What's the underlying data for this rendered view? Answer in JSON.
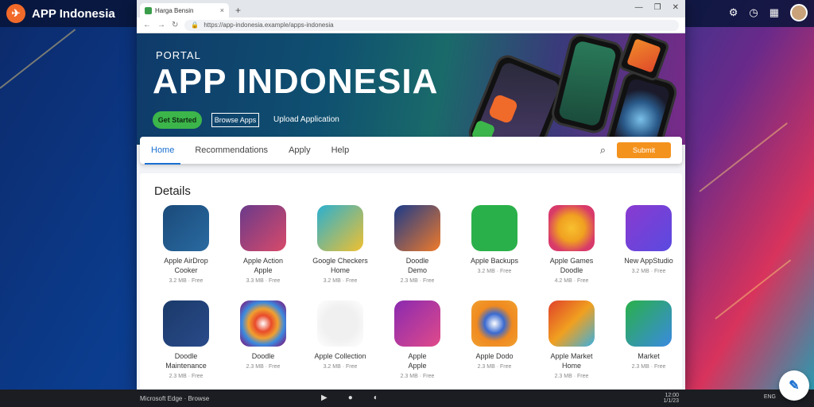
{
  "desktop": {
    "title": "APP Indonesia",
    "logo_glyph": "✈"
  },
  "browser": {
    "tab_title": "Harga Bensin",
    "url": "https://app-indonesia.example/apps-indonesia"
  },
  "hero": {
    "eyebrow": "PORTAL",
    "title": "APP INDONESIA",
    "primary_button": "Get Started",
    "secondary_button": "Browse Apps",
    "link": "Upload Application"
  },
  "nav": {
    "items": [
      "Home",
      "Recommendations",
      "Apply",
      "Help"
    ],
    "search_icon": "search-icon",
    "cta": "Submit"
  },
  "section": {
    "title": "Details"
  },
  "apps": [
    {
      "name": "Apple AirDrop",
      "sub": "Cooker",
      "size": "3.2 MB · Free"
    },
    {
      "name": "Apple Action",
      "sub": "Apple",
      "size": "3.3 MB · Free"
    },
    {
      "name": "Google Checkers",
      "sub": "Home",
      "size": "3.2 MB · Free"
    },
    {
      "name": "Doodle",
      "sub": "Demo",
      "size": "2.3 MB · Free"
    },
    {
      "name": "Apple Backups",
      "sub": "",
      "size": "3.2 MB · Free"
    },
    {
      "name": "Apple Games",
      "sub": "Doodle",
      "size": "4.2 MB · Free"
    },
    {
      "name": "New AppStudio",
      "sub": "",
      "size": "3.2 MB · Free"
    },
    {
      "name": "Doodle",
      "sub": "Maintenance",
      "size": "2.3 MB · Free"
    },
    {
      "name": "Doodle",
      "sub": "",
      "size": "2.3 MB · Free"
    },
    {
      "name": "Apple Collection",
      "sub": "",
      "size": "3.2 MB · Free"
    },
    {
      "name": "Apple",
      "sub": "Apple",
      "size": "2.3 MB · Free"
    },
    {
      "name": "Apple Dodo",
      "sub": "",
      "size": "2.3 MB · Free"
    },
    {
      "name": "Apple Market",
      "sub": "Home",
      "size": "2.3 MB · Free"
    },
    {
      "name": "Market",
      "sub": "",
      "size": "2.3 MB · Free"
    }
  ],
  "taskbar": {
    "left_text": "Microsoft Edge · Browse",
    "clock_line1": "12:00",
    "clock_line2": "1/1/23",
    "far_right": "ENG"
  },
  "colors": {
    "accent": "#1a6fd0",
    "green": "#3cb64a",
    "orange": "#f4921e"
  }
}
